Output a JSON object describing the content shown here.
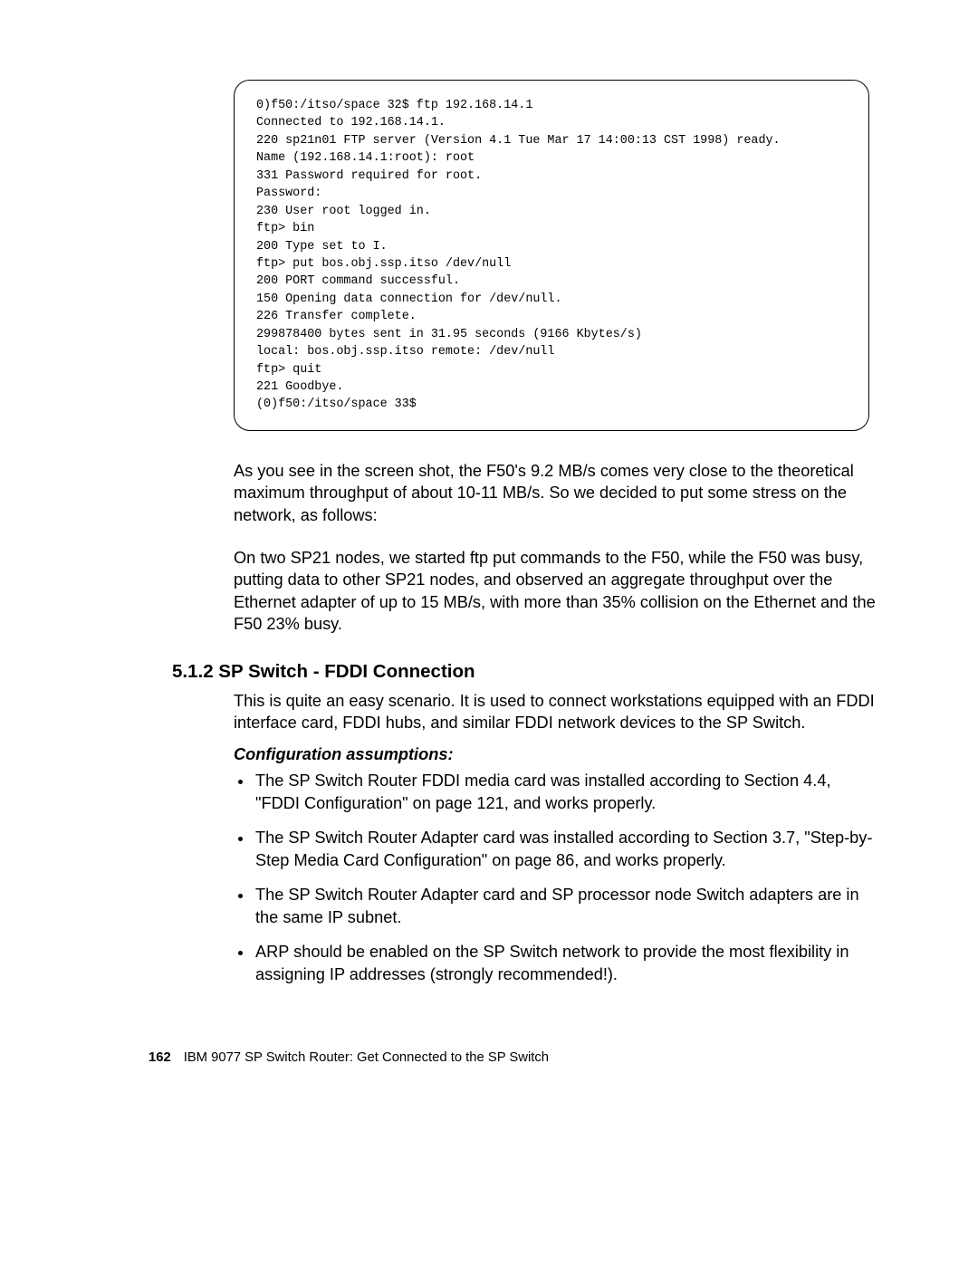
{
  "codeBlock": "0)f50:/itso/space 32$ ftp 192.168.14.1\nConnected to 192.168.14.1.\n220 sp21n01 FTP server (Version 4.1 Tue Mar 17 14:00:13 CST 1998) ready.\nName (192.168.14.1:root): root\n331 Password required for root.\nPassword:\n230 User root logged in.\nftp> bin\n200 Type set to I.\nftp> put bos.obj.ssp.itso /dev/null\n200 PORT command successful.\n150 Opening data connection for /dev/null.\n226 Transfer complete.\n299878400 bytes sent in 31.95 seconds (9166 Kbytes/s)\nlocal: bos.obj.ssp.itso remote: /dev/null\nftp> quit\n221 Goodbye.\n(0)f50:/itso/space 33$",
  "para1": "As you see in the screen shot, the F50's 9.2 MB/s comes very close to the theoretical maximum throughput of about 10-11 MB/s. So we decided to put some stress on the network, as follows:",
  "para2": "On two SP21 nodes, we started ftp put commands to the F50, while the F50 was busy, putting data to other SP21 nodes, and observed an aggregate throughput over the Ethernet adapter of up to 15 MB/s, with more than 35% collision on the Ethernet and the F50 23% busy.",
  "heading": "5.1.2  SP Switch - FDDI Connection",
  "para3": "This is quite an easy scenario. It is used to connect workstations equipped with an FDDI interface card, FDDI hubs, and similar FDDI network devices to the SP Switch.",
  "subheading": "Configuration assumptions:",
  "bullets": [
    "The SP Switch Router FDDI media card was installed according to Section 4.4, \"FDDI Configuration\" on page 121, and works properly.",
    "The SP Switch Router Adapter card was installed according to Section 3.7, \"Step-by-Step Media Card Configuration\" on page 86, and works properly.",
    "The SP Switch Router Adapter card and SP processor node Switch adapters are in the same IP subnet.",
    "ARP should be enabled on the SP Switch network to provide the most flexibility in assigning IP addresses (strongly recommended!)."
  ],
  "footer": {
    "pageNum": "162",
    "title": "IBM 9077 SP Switch Router: Get Connected to the SP Switch"
  }
}
